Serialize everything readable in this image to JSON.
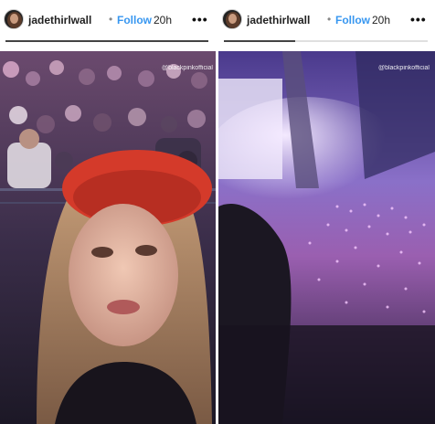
{
  "stories": [
    {
      "username": "jadethirlwall",
      "dot": "•",
      "follow_label": "Follow",
      "time": "20h",
      "more_icon": "•••",
      "watermark": "@blackpinkofficial",
      "progress_fraction": 1.0
    },
    {
      "username": "jadethirlwall",
      "dot": "•",
      "follow_label": "Follow",
      "time": "20h",
      "more_icon": "•••",
      "watermark": "@blackpinkofficial",
      "progress_fraction": 0.35
    }
  ]
}
